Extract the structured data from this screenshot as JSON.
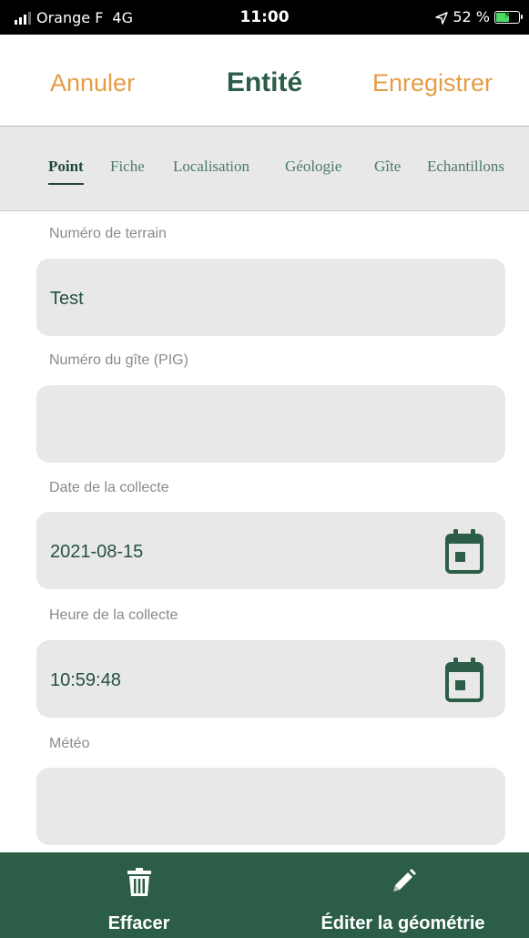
{
  "status_bar": {
    "carrier": "Orange F",
    "network": "4G",
    "time": "11:00",
    "battery": "52 %",
    "battery_level": 0.52
  },
  "header": {
    "cancel_label": "Annuler",
    "title": "Entité",
    "save_label": "Enregistrer"
  },
  "tabs": [
    {
      "label": "Point",
      "active": true
    },
    {
      "label": "Fiche",
      "active": false
    },
    {
      "label": "Localisation",
      "active": false
    },
    {
      "label": "Géologie",
      "active": false
    },
    {
      "label": "Gîte",
      "active": false
    },
    {
      "label": "Echantillons",
      "active": false
    }
  ],
  "form": {
    "numero_terrain": {
      "label": "Numéro de terrain",
      "value": "Test"
    },
    "numero_gite": {
      "label": "Numéro du gîte (PIG)",
      "value": ""
    },
    "date_collecte": {
      "label": "Date de la collecte",
      "value": "2021-08-15",
      "icon": "calendar-icon"
    },
    "heure_collecte": {
      "label": "Heure de la collecte",
      "value": "10:59:48",
      "icon": "calendar-icon"
    },
    "meteo": {
      "label": "Météo",
      "value": ""
    }
  },
  "bottom_bar": {
    "delete_label": "Effacer",
    "delete_icon": "trash-icon",
    "edit_geometry_label": "Éditer la géométrie",
    "edit_geometry_icon": "pencil-icon"
  },
  "colors": {
    "accent_orange": "#e69b45",
    "brand_green": "#2b5d47",
    "field_bg": "#e8e8e8"
  }
}
